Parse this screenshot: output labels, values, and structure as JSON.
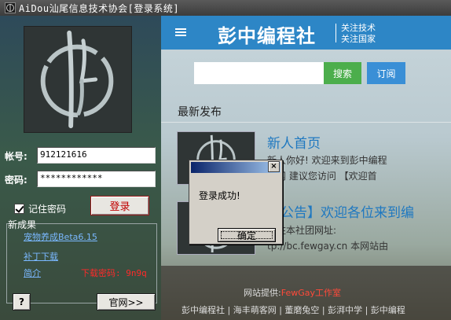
{
  "window": {
    "title": "AiDou汕尾信息技术协会[登录系统]"
  },
  "login": {
    "account_label": "帐号:",
    "account_value": "912121616",
    "password_label": "密码:",
    "password_value": "************",
    "remember_label": "记住密码",
    "remember_checked": true,
    "login_button": "登录"
  },
  "results": {
    "legend": "新成果",
    "link1": "宠物养成Beta6.15",
    "link2": "补丁下载",
    "link3": "简介",
    "password_note": "下载密码: 9n9q"
  },
  "bottom_buttons": {
    "help": "?",
    "website": "官网>>"
  },
  "web": {
    "brand": "彭中编程社",
    "slogan1": "关注技术",
    "slogan2": "关注国家",
    "search_button": "搜索",
    "subscribe_button": "订阅",
    "section_title": "最新发布",
    "news": [
      {
        "title": "新人首页",
        "line1": "新人你好! 欢迎来到彭中编程",
        "line2": "官网 建议您访问 【欢迎首"
      },
      {
        "title": "【公告】欢迎各位来到编",
        "line1": "已住本社团网址:",
        "line2": "tp://bc.fewgay.cn 本网站由"
      }
    ],
    "footer_provider_label": "网站提供:",
    "footer_provider_name": "FewGay工作室",
    "footer_links": "彭中编程社 | 海丰萌客网 | 董磨兔空 | 彭湃中学 | 彭中编程"
  },
  "dialog": {
    "message": "登录成功!",
    "ok_button": "确定",
    "close": "×"
  },
  "colors": {
    "header_blue": "#2d86c6",
    "search_green": "#4cae4c",
    "subscribe_blue": "#3a8fd6",
    "link_blue": "#1f78c0",
    "warn_red": "#ff2a2a"
  },
  "icons": {
    "app": "aidou-logo-icon",
    "menu": "menu-icon",
    "avatar": "aidou-logo-icon"
  }
}
